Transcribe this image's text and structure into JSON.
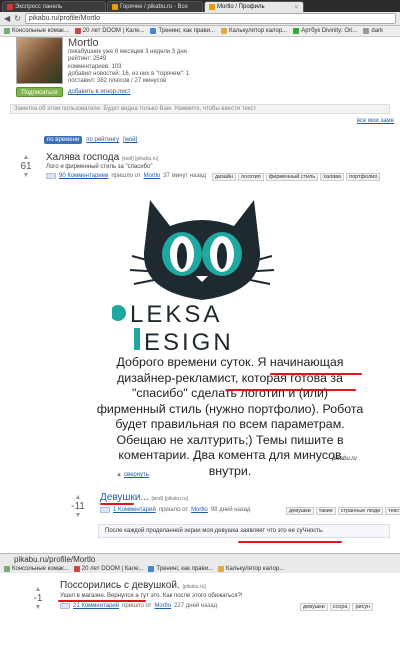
{
  "browser": {
    "tabs": [
      {
        "label": "Экспресс панель",
        "active": false
      },
      {
        "label": "Горячее / pikabu.ru - Все",
        "active": false
      },
      {
        "label": "Mortlo / Профиль",
        "active": true
      }
    ],
    "address": "pikabu.ru/profile/Mortlo",
    "bookmarks": [
      "Консольные комак...",
      "20 лет DOOM | Кале...",
      "Тренинг, как прави...",
      "Калькулятор калор...",
      "Артбук Divinity: Ori...",
      "dark"
    ]
  },
  "profile": {
    "name": "Mortlo",
    "info": [
      "пикабушник уже 8 месяцев 3 недели 3 дня",
      "рейтинг: 2549",
      "комментариев: 103",
      "добавил новостей: 16, из них в \"горячем\": 1",
      "поставил: 382 плюсов / 27 минусов"
    ],
    "subscribe_label": "Подписаться",
    "ignore_label": "добавить в игнор-лист",
    "note_placeholder": "Заметка об этом пользователе. Будет видна только Вам. Нажмите, чтобы ввести текст"
  },
  "all_my": "все мои заме",
  "sorter": {
    "by_time": "по времени",
    "by_rating": "по рейтингу",
    "mine": "[мой]"
  },
  "posts": [
    {
      "rating": "61",
      "title": "Халява господа",
      "title_extra": "[мой] [pikabu.ru]",
      "subtitle": "Лого и фирменный стиль за \"спасибо\"",
      "comments_link": "90 Комментариев",
      "meta_rest": "пришло от",
      "author": "Mortlo",
      "time": "37 минут назад",
      "tags": [
        "дизайн",
        "логотип",
        "фирменный стиль",
        "халява",
        "портфолио"
      ]
    },
    {
      "rating": "-11",
      "title": "Девушки...",
      "title_extra": "[мой] [pikabu.ru]",
      "comments_link": "1 Комментарий",
      "meta_rest": "пришло от",
      "author": "Mortlo",
      "time": "98 дней назад",
      "tags": [
        "девушки",
        "такие",
        "странные люди",
        "текст"
      ],
      "quote": "После каждой проделанной херни моя девушка заявляет что это ее суЧность."
    },
    {
      "rating": "-1",
      "title": "Поссорились с девушкой.",
      "title_extra": "[pikabu.ru]",
      "subtitle": "Ушел в магазин. Вернулся а тут это. Как после этого обижаться?!",
      "comments_link": "21 Комментарий",
      "meta_rest": "пришло от",
      "author": "Mortlo",
      "time": "227 дней назад",
      "tags": [
        "девушки",
        "ссора",
        "рисун"
      ]
    }
  ],
  "image": {
    "logo_line1": "LEKSA",
    "logo_line2": "ESIGN",
    "text": "Доброго времени суток. Я начинающая дизайнер-рекламист, которая готова за \"спасибо\" сделать логотип и (или) фирменный стиль (нужно портфолио). Робота будет правильная по всем параметрам. Обещаю не халтурить;)  Темы пишите в коментарии. Два комента для минусов внутри.",
    "watermark": "pikabu.ru"
  },
  "collapse_label": "свернуть",
  "overlay": {
    "address": "pikabu.ru/profile/Mortlo",
    "bookmarks": [
      "Консольные комак...",
      "20 лет DOOM | Кале...",
      "Тренинг, как прави...",
      "Калькулятор калор..."
    ]
  },
  "colors": {
    "accent": "#1e5ea8",
    "teal": "#1fa8a0",
    "logo_dark": "#1f2a30",
    "red": "#e3151b"
  }
}
